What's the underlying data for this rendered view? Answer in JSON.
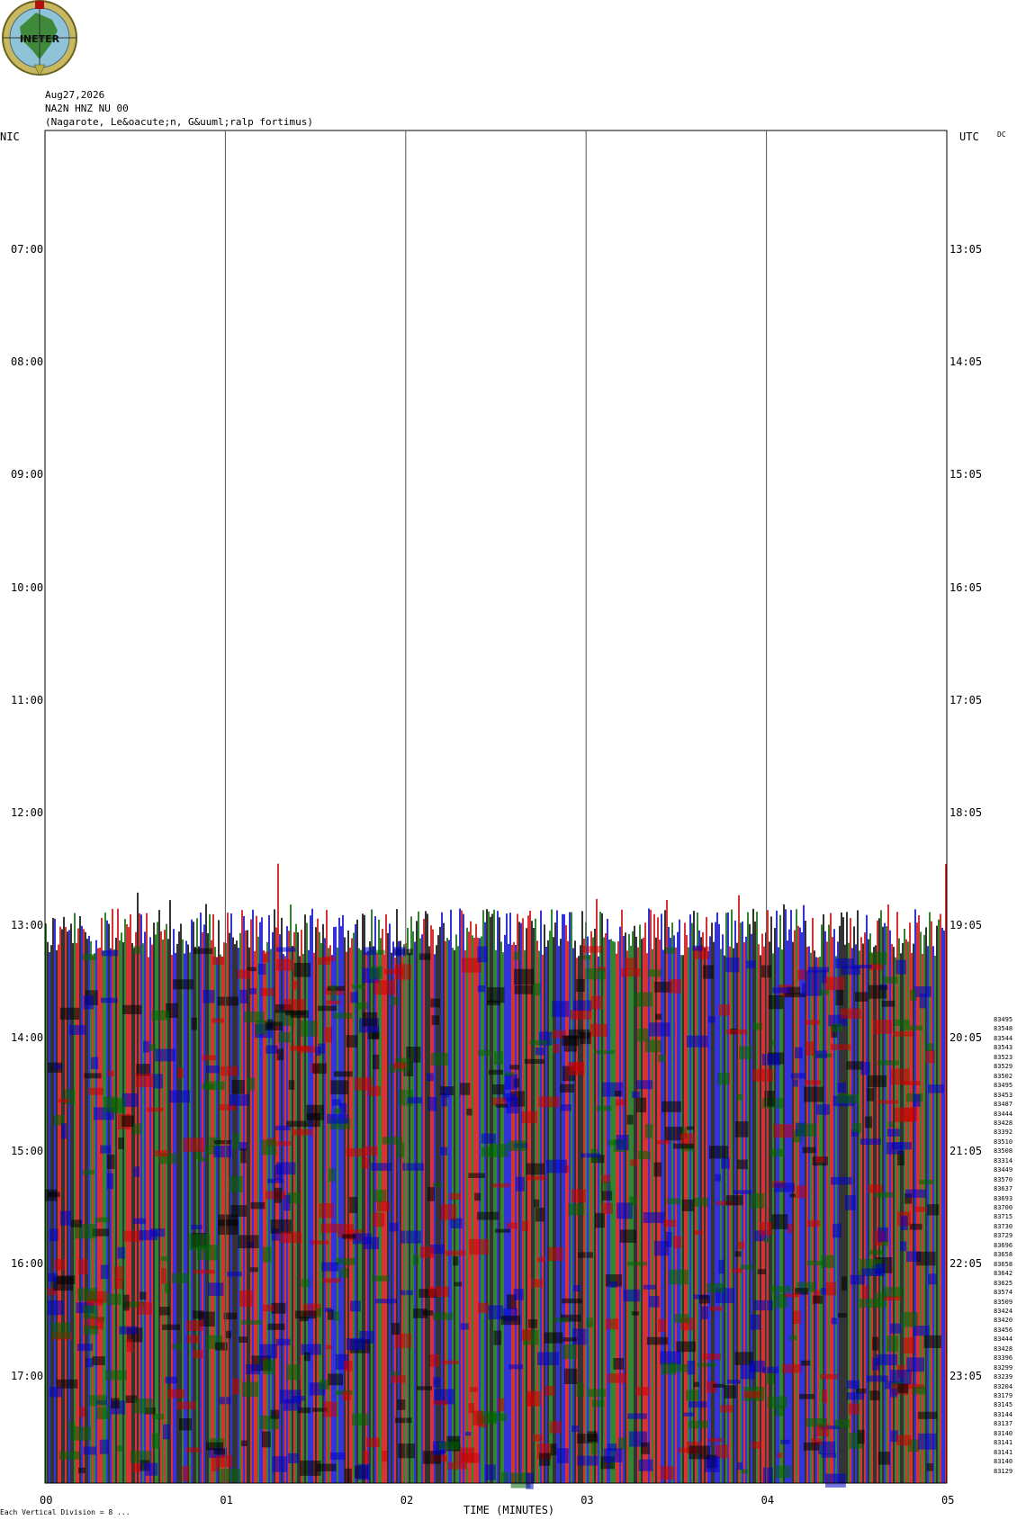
{
  "header": {
    "date": "Aug27,2026",
    "channel": "NA2N HNZ NU 00",
    "location": "(Nagarote, Le&oacute;n, G&uuml;ralp fortimus)"
  },
  "logo": {
    "text": "INETER"
  },
  "labels": {
    "left_zone": "NIC",
    "right_zone": "UTC",
    "dc": "DC"
  },
  "footer": {
    "prefix": "Each",
    "text": "Each Vertical Division = 8 ...",
    "xlabel": "TIME (MINUTES)"
  },
  "chart_data": {
    "type": "heatmap",
    "title": "",
    "xlabel": "TIME (MINUTES)",
    "x_ticks": [
      "00",
      "01",
      "02",
      "03",
      "04",
      "05"
    ],
    "x_range": [
      0,
      5
    ],
    "left_ticks": [
      "07:00",
      "08:00",
      "09:00",
      "10:00",
      "11:00",
      "12:00",
      "13:00",
      "14:00",
      "15:00",
      "16:00",
      "17:00"
    ],
    "right_ticks": [
      "13:05",
      "14:05",
      "15:05",
      "16:05",
      "17:05",
      "18:05",
      "19:05",
      "20:05",
      "21:05",
      "22:05",
      "23:05"
    ],
    "trace_colors": [
      "#0000cc",
      "#cc0000",
      "#006600",
      "#000000"
    ],
    "trace_start_hour": 12.85,
    "trace_counts": [
      "83495",
      "83548",
      "83544",
      "83543",
      "83523",
      "83529",
      "83502",
      "83495",
      "83453",
      "83487",
      "83444",
      "83428",
      "83392",
      "83510",
      "83508",
      "83314",
      "83449",
      "83570",
      "83637",
      "83693",
      "83700",
      "83715",
      "83730",
      "83729",
      "83696",
      "83658",
      "83658",
      "83642",
      "83625",
      "83574",
      "83509",
      "83424",
      "83420",
      "83456",
      "83444",
      "83428",
      "83396",
      "83299",
      "83239",
      "83204",
      "83179",
      "83145",
      "83144",
      "83137",
      "83140",
      "83141",
      "83141",
      "83140",
      "83129"
    ]
  }
}
